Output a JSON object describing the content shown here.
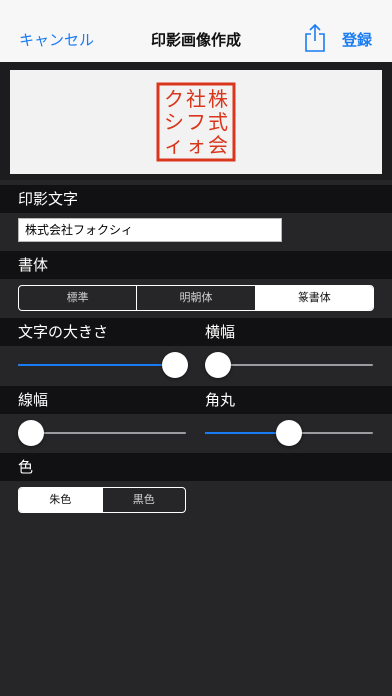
{
  "navbar": {
    "cancel_label": "キャンセル",
    "title": "印影画像作成",
    "share_icon": "share-icon",
    "register_label": "登録"
  },
  "preview": {
    "seal_lines": [
      "株式会",
      "社フォ",
      "クシィ"
    ],
    "seal_color": "#d9361c"
  },
  "sections": {
    "seal_text_label": "印影文字",
    "font_label": "書体",
    "char_size_label": "文字の大きさ",
    "width_label": "横幅",
    "line_width_label": "線幅",
    "corner_label": "角丸",
    "color_label": "色"
  },
  "seal_text": {
    "value": "株式会社フォクシィ"
  },
  "font_options": [
    "標準",
    "明朝体",
    "篆書体"
  ],
  "font_selected": "篆書体",
  "sliders": {
    "char_size": 1.0,
    "width": 0.0,
    "line_width": 0.0,
    "corner": 0.5
  },
  "color_options": [
    "朱色",
    "黒色"
  ],
  "color_selected": "朱色",
  "accent": "#1a7cf4"
}
